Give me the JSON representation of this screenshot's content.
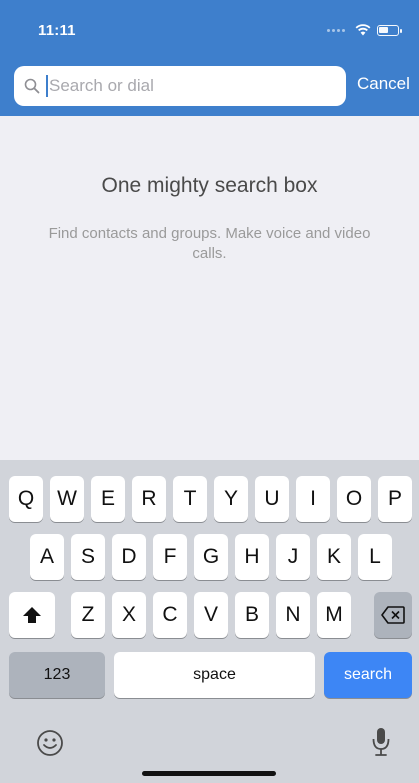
{
  "status_bar": {
    "time": "11:11"
  },
  "search": {
    "placeholder": "Search or dial",
    "value": "",
    "cancel_label": "Cancel"
  },
  "empty_state": {
    "title": "One mighty search box",
    "subtitle": "Find contacts and groups. Make voice and video calls."
  },
  "keyboard": {
    "row1": [
      "Q",
      "W",
      "E",
      "R",
      "T",
      "Y",
      "U",
      "I",
      "O",
      "P"
    ],
    "row2": [
      "A",
      "S",
      "D",
      "F",
      "G",
      "H",
      "J",
      "K",
      "L"
    ],
    "row3": [
      "Z",
      "X",
      "C",
      "V",
      "B",
      "N",
      "M"
    ],
    "numbers_label": "123",
    "space_label": "space",
    "search_label": "search"
  },
  "colors": {
    "header": "#3e7fcc",
    "accent": "#3d86f5",
    "keyboard_bg": "#d1d4da"
  }
}
